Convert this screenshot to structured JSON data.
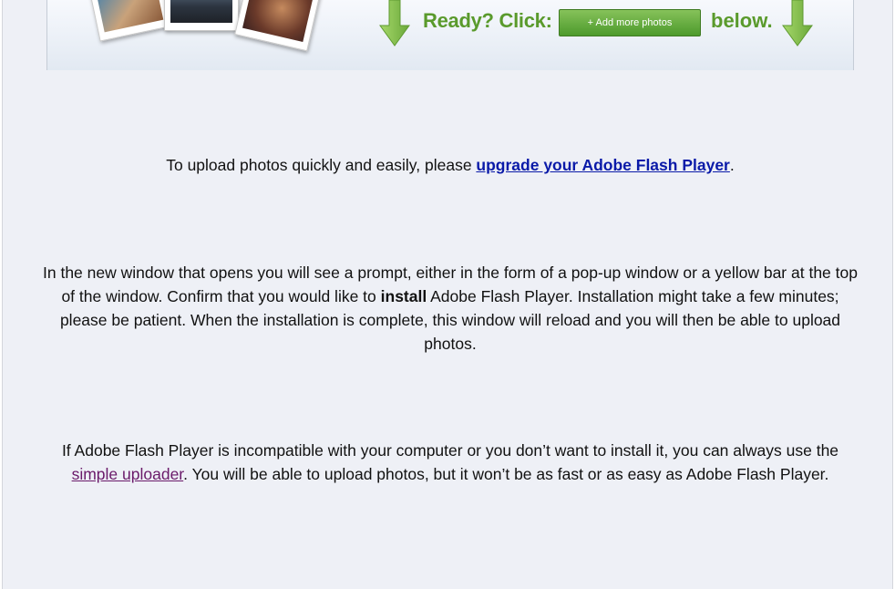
{
  "banner": {
    "ready_label": "Ready? Click:",
    "button_label": "+ Add more photos",
    "below_label": "below."
  },
  "intro": {
    "prefix": "To upload photos quickly and easily, please ",
    "link": "upgrade your Adobe Flash Player",
    "suffix": "."
  },
  "install": {
    "part1": "In the new window that opens you will see a prompt, either in the form of a pop-up window or a yellow bar at the top of the window. Confirm that you would like to ",
    "bold": "install",
    "part2": " Adobe Flash Player. Installation might take a few minutes; please be patient. When the installation is complete, this window will reload and you will then be able to upload photos."
  },
  "fallback": {
    "part1": "If Adobe Flash Player is incompatible with your computer or you don’t want to install it, you can always use the ",
    "link": "simple uploader",
    "part2": ". You will be able to upload photos, but it won’t be as fast or as easy as Adobe Flash Player."
  },
  "colors": {
    "accent_green": "#5a9a2c",
    "link_blue": "#0a1aa8",
    "visited_purple": "#6a1a6a",
    "panel_bg": "#eef0f6"
  }
}
